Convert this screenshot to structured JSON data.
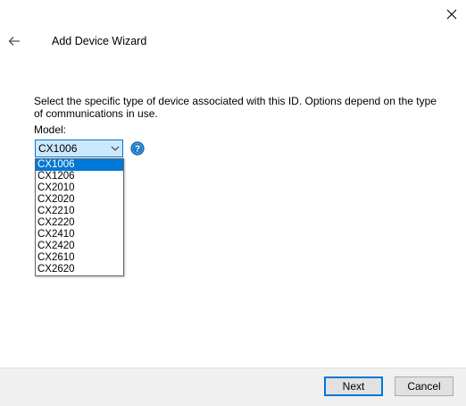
{
  "window": {
    "close_icon": "close-icon",
    "back_icon": "arrow-left-icon",
    "title": "Add Device Wizard"
  },
  "main": {
    "description": "Select the specific type of device associated with this ID. Options depend on the type of communications in use.",
    "model_label": "Model:",
    "model_select": {
      "value": "CX1006",
      "chevron_icon": "chevron-down-icon",
      "options": [
        "CX1006",
        "CX1206",
        "CX2010",
        "CX2020",
        "CX2210",
        "CX2220",
        "CX2410",
        "CX2420",
        "CX2610",
        "CX2620"
      ],
      "selected_index": 0
    },
    "help_icon": "help-icon",
    "colors": {
      "accent": "#0078d7",
      "select_bg": "#cce8ff",
      "help_icon": "#1e7ac8"
    }
  },
  "footer": {
    "next_label": "Next",
    "cancel_label": "Cancel"
  }
}
